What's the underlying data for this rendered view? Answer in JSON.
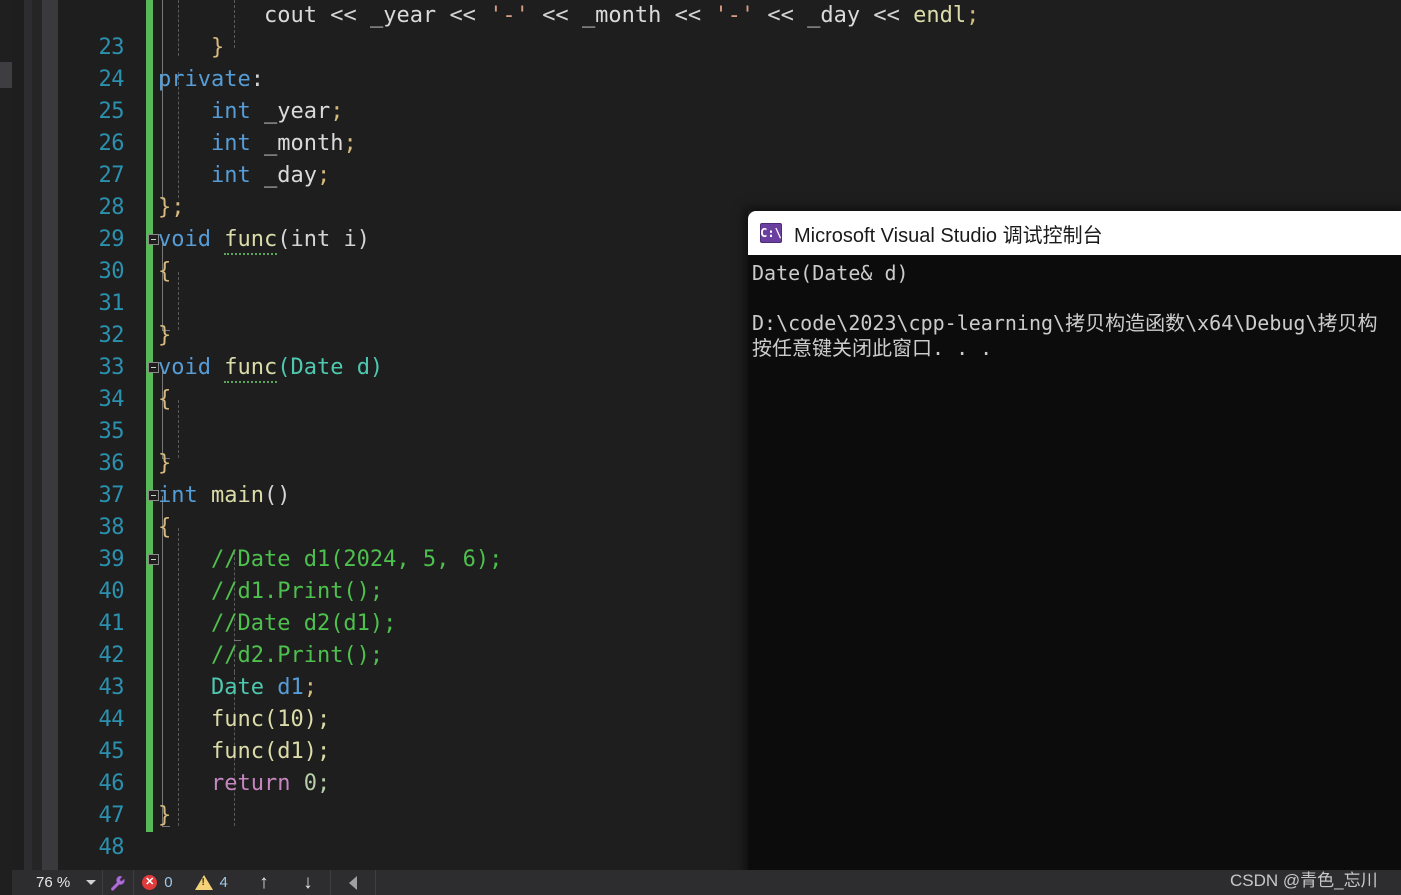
{
  "editor": {
    "first_line_number": 23,
    "lines": [
      {
        "n": 23,
        "text": "        cout << _year << '-' << _month << '-' << _day << endl;"
      },
      {
        "n": 24,
        "text": "    }"
      },
      {
        "n": 25,
        "text": "private:"
      },
      {
        "n": 26,
        "text": "    int _year;"
      },
      {
        "n": 27,
        "text": "    int _month;"
      },
      {
        "n": 28,
        "text": "    int _day;"
      },
      {
        "n": 29,
        "text": "};"
      },
      {
        "n": 30,
        "text": "void func(int i)"
      },
      {
        "n": 31,
        "text": "{"
      },
      {
        "n": 32,
        "text": ""
      },
      {
        "n": 33,
        "text": "}"
      },
      {
        "n": 34,
        "text": "void func(Date d)"
      },
      {
        "n": 35,
        "text": "{"
      },
      {
        "n": 36,
        "text": ""
      },
      {
        "n": 37,
        "text": "}"
      },
      {
        "n": 38,
        "text": "int main()"
      },
      {
        "n": 39,
        "text": "{"
      },
      {
        "n": 40,
        "text": "    //Date d1(2024, 5, 6);"
      },
      {
        "n": 41,
        "text": "    //d1.Print();"
      },
      {
        "n": 42,
        "text": "    //Date d2(d1);"
      },
      {
        "n": 43,
        "text": "    //d2.Print();"
      },
      {
        "n": 44,
        "text": "    Date d1;"
      },
      {
        "n": 45,
        "text": "    func(10);"
      },
      {
        "n": 46,
        "text": "    func(d1);"
      },
      {
        "n": 47,
        "text": "    return 0;"
      },
      {
        "n": 48,
        "text": "}"
      }
    ],
    "tokens": {
      "cout": "cout",
      "shift": "<<",
      "_year": "_year",
      "_month": "_month",
      "_day": "_day",
      "endl": "endl",
      "dash_char": "'-'",
      "semicolon": ";",
      "close_brace": "}",
      "private": "private",
      "colon": ":",
      "int": "int",
      "brace_semi": "};",
      "void": "void",
      "func": "func",
      "paren_int_i": "(int i)",
      "paren_date_d": "(Date d)",
      "open_brace": "{",
      "main": "main",
      "empty_parens": "()",
      "comment_date_d1": "//Date d1(2024, 5, 6);",
      "comment_d1_print": "//d1.Print();",
      "comment_date_d2": "//Date d2(d1);",
      "comment_d2_print": "//d2.Print();",
      "Date": "Date",
      "d1": "d1",
      "func_10": "func(10);",
      "func_d1": "func(d1);",
      "return": "return",
      "zero_semi": "0;"
    }
  },
  "console": {
    "title": "Microsoft Visual Studio 调试控制台",
    "icon": "console-cmd-icon",
    "icon_text": "C:\\",
    "lines": [
      "Date(Date& d)",
      "",
      "D:\\code\\2023\\cpp-learning\\拷贝构造函数\\x64\\Debug\\拷贝构",
      "按任意键关闭此窗口. . ."
    ]
  },
  "statusbar": {
    "zoom_level": "76 %",
    "zoom_caret": "chevron-down-icon",
    "wrench_icon": "wrench-icon",
    "error_icon": "error-icon",
    "error_glyph": "✕",
    "error_count": "0",
    "warning_icon": "warning-icon",
    "warning_count": "4",
    "nav_up": "↑",
    "nav_down": "↓",
    "nav_prev": "triangle-left-icon"
  },
  "watermark": {
    "text": "CSDN @青色_忘川"
  },
  "colors": {
    "editor_background": "#1e1e1e",
    "line_number": "#2b91af",
    "keyword": "#569cd6",
    "type": "#4ec9b0",
    "function": "#dcdcaa",
    "control": "#c586c0",
    "comment": "#4ec04e",
    "string": "#d69d85",
    "number": "#b5cea8",
    "brace": "#d7ba7d",
    "change_bar": "#57b957",
    "console_background": "#0c0c0c",
    "console_title_background": "#ffffff",
    "statusbar_background": "#2d2d30",
    "error_red": "#e03a3a",
    "warning_yellow": "#f5d27a",
    "console_icon_purple": "#6a3fa0"
  }
}
